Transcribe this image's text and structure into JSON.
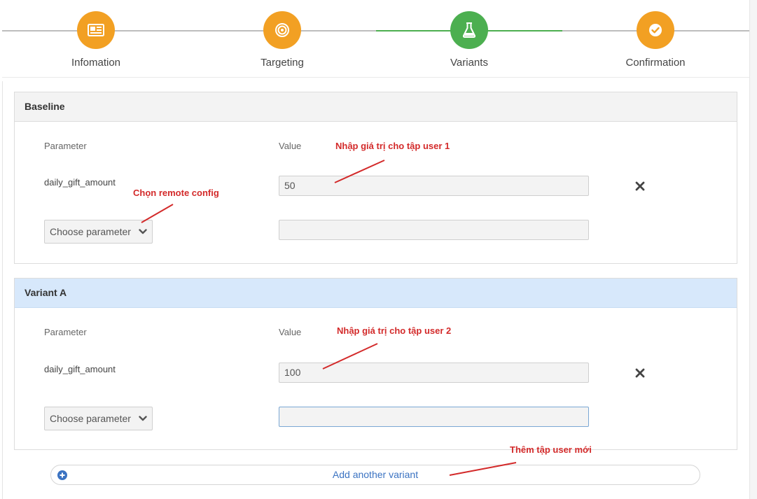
{
  "stepper": {
    "steps": [
      {
        "label": "Infomation",
        "icon": "newspaper-icon",
        "state": "done"
      },
      {
        "label": "Targeting",
        "icon": "target-icon",
        "state": "done"
      },
      {
        "label": "Variants",
        "icon": "flask-icon",
        "state": "active"
      },
      {
        "label": "Confirmation",
        "icon": "check-circle-icon",
        "state": "done"
      }
    ],
    "colors": {
      "done": "#f2a023",
      "active": "#4caf50",
      "track": "#bdbdbd"
    }
  },
  "baseline": {
    "title": "Baseline",
    "param_header": "Parameter",
    "value_header": "Value",
    "param_name": "daily_gift_amount",
    "param_value": "50",
    "new_param_value": "",
    "choose_label": "Choose parameter"
  },
  "variant_a": {
    "title": "Variant A",
    "param_header": "Parameter",
    "value_header": "Value",
    "param_name": "daily_gift_amount",
    "param_value": "100",
    "new_param_value": "",
    "choose_label": "Choose parameter"
  },
  "add_variant": {
    "label": "Add another variant"
  },
  "annotations": {
    "note_user1": "Nhập giá trị cho tập user 1",
    "note_remote": "Chọn remote config",
    "note_user2": "Nhập giá trị cho tập user 2",
    "note_new": "Thêm tập user mới",
    "color": "#d32a2a"
  }
}
